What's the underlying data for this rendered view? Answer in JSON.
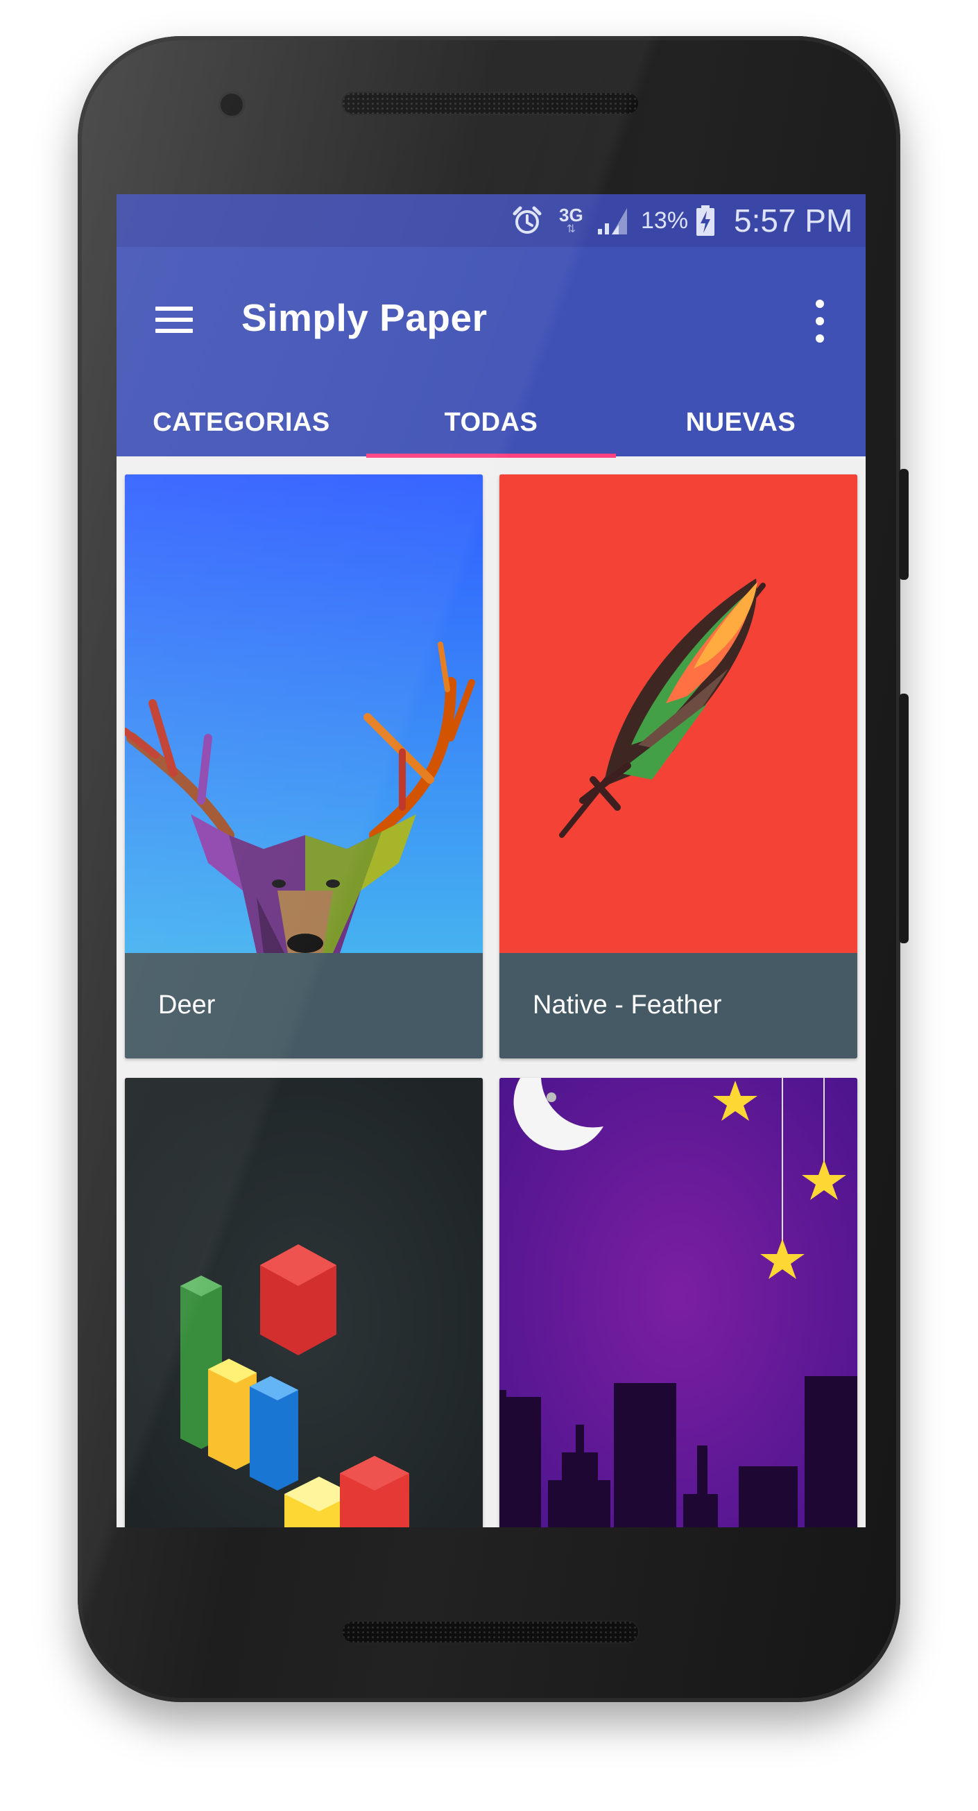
{
  "status_bar": {
    "network": "3G",
    "battery": "13%",
    "time": "5:57 PM",
    "icons": [
      "alarm-icon",
      "network-3g-icon",
      "signal-icon",
      "battery-charging-icon"
    ]
  },
  "app_bar": {
    "title": "Simply Paper",
    "menu_icon": "menu-icon",
    "overflow_icon": "more-vert-icon"
  },
  "tabs": [
    {
      "label": "CATEGORIAS",
      "selected": false
    },
    {
      "label": "TODAS",
      "selected": true
    },
    {
      "label": "NUEVAS",
      "selected": false
    }
  ],
  "wallpapers": [
    {
      "title": "Deer"
    },
    {
      "title": "Native - Feather"
    },
    {
      "title": ""
    },
    {
      "title": ""
    }
  ],
  "colors": {
    "primary": "#3f51b5",
    "primary_dark": "#3a47a6",
    "accent": "#ff4081",
    "card_footer": "#455a64"
  }
}
